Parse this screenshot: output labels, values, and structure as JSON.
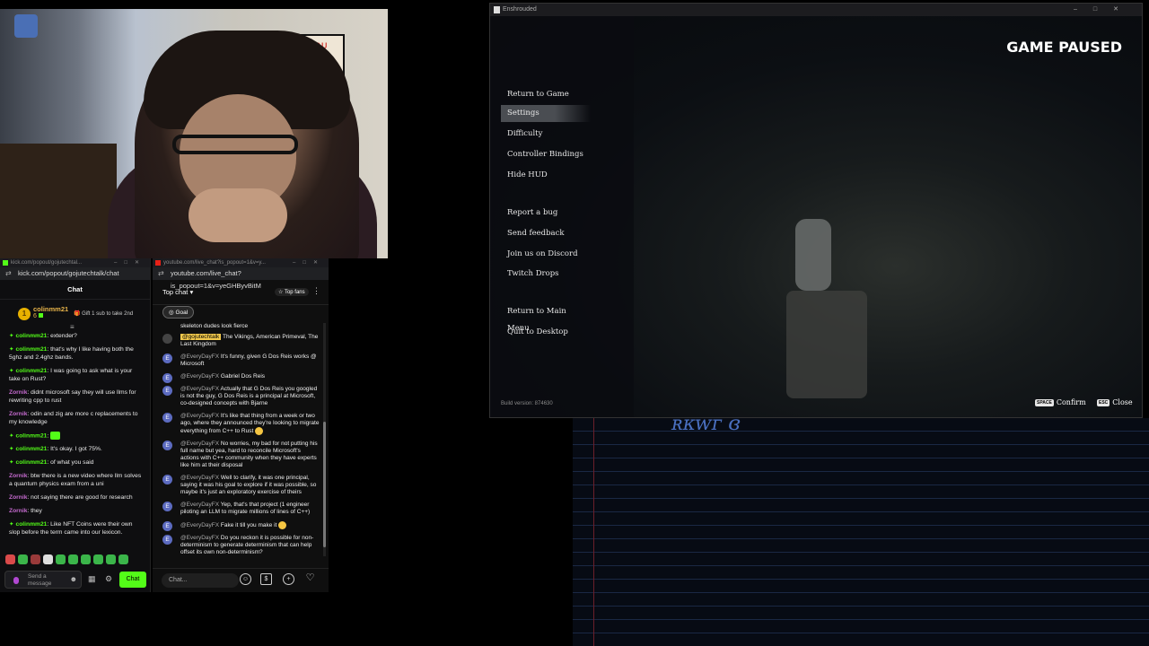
{
  "kick": {
    "tab_url": "kick.com/popout/gojutechtal...",
    "url": "kick.com/popout/gojutechtalk/chat",
    "header": "Chat",
    "pinned": {
      "user": "colinmm21",
      "count": "6",
      "gift_text": "Gift 1 sub to take 2nd"
    },
    "messages": [
      {
        "user": "colinmm21",
        "text": ": extender?"
      },
      {
        "user": "colinmm21",
        "text": ": that's why I like having both the 5ghz and 2.4ghz bands."
      },
      {
        "user": "colinmm21",
        "text": ": I was going to ask what is your take on Rust?"
      },
      {
        "user": "Zornik",
        "text": ": didnt microsoft say they will use llms for rewriting cpp to rust"
      },
      {
        "user": "Zornik",
        "text": ": odin and zig are more c replacements to my knowledge"
      },
      {
        "user": "colinmm21",
        "text": ": "
      },
      {
        "user": "colinmm21",
        "text": ": It's okay. I got 75%."
      },
      {
        "user": "colinmm21",
        "text": ": of what you said"
      },
      {
        "user": "Zornik",
        "text": ": btw there is a new video where llm solves a quantum physics exam from a uni"
      },
      {
        "user": "Zornik",
        "text": ": not saying there are good for research"
      },
      {
        "user": "Zornik",
        "text": ": they"
      },
      {
        "user": "colinmm21",
        "text": ": Like NFT Coins were their own slop before the term came into our lexicon."
      }
    ],
    "input_placeholder": "Send a message",
    "chat_button": "Chat"
  },
  "youtube": {
    "tab_url": "youtube.com/live_chat?is_popout=1&v=y...",
    "url": "youtube.com/live_chat?is_popout=1&v=yeGHByvBitM",
    "top_chat": "Top chat",
    "top_fans": "Top fans",
    "goal": "Goal",
    "partial_top": "skeleton dudes look fierce",
    "messages": [
      {
        "user": "@gojutechtalk",
        "text": "The Vikings, American Primeval, The Last Kingdom",
        "highlight": true
      },
      {
        "user": "@EveryDayFX",
        "text": "It's funny, given G Dos Reis works @ Microsoft"
      },
      {
        "user": "@EveryDayFX",
        "text": "Gabriel Dos Reis"
      },
      {
        "user": "@EveryDayFX",
        "text": "Actually that G Dos Reis you googled is not the guy, G Dos Reis is a principal at Microsoft, co-designed concepts with Bjarne"
      },
      {
        "user": "@EveryDayFX",
        "text": "It's like that thing from a week or two ago, where they announced they're looking to migrate everything from C++ to Rust"
      },
      {
        "user": "@EveryDayFX",
        "text": "No worries, my bad for not putting his full name  but yea, hard to reconcile Microsoft's actions with C++ community when they have experts like him at their disposal"
      },
      {
        "user": "@EveryDayFX",
        "text": "Well to clarify, it was one principal, saying it was his goal to explore if it was possible, so maybe it's just an exploratory exercise of theirs"
      },
      {
        "user": "@EveryDayFX",
        "text": "Yep, that's that project (1 engineer piloting an LLM to migrate millions of lines of C++)"
      },
      {
        "user": "@EveryDayFX",
        "text": "Fake it till you make it"
      },
      {
        "user": "@EveryDayFX",
        "text": "Do you reckon it is possible for non-determinism to generate determinism that can help offset its own non-determinism?"
      }
    ],
    "input_placeholder": "Chat..."
  },
  "game": {
    "window_title": "Enshrouded",
    "paused_title": "GAME PAUSED",
    "menu_group1": [
      "Return to Game",
      "Settings",
      "Difficulty",
      "Controller Bindings",
      "Hide HUD"
    ],
    "menu_group2": [
      "Report a bug",
      "Send feedback",
      "Join us on Discord",
      "Twitch Drops"
    ],
    "menu_group3": [
      "Return to Main Menu",
      "Quit to Desktop"
    ],
    "active_item": "Settings",
    "build": "Build version: 874630",
    "hint_confirm_key": "SPACE",
    "hint_confirm": "Confirm",
    "hint_close_key": "ESC",
    "hint_close": "Close"
  }
}
